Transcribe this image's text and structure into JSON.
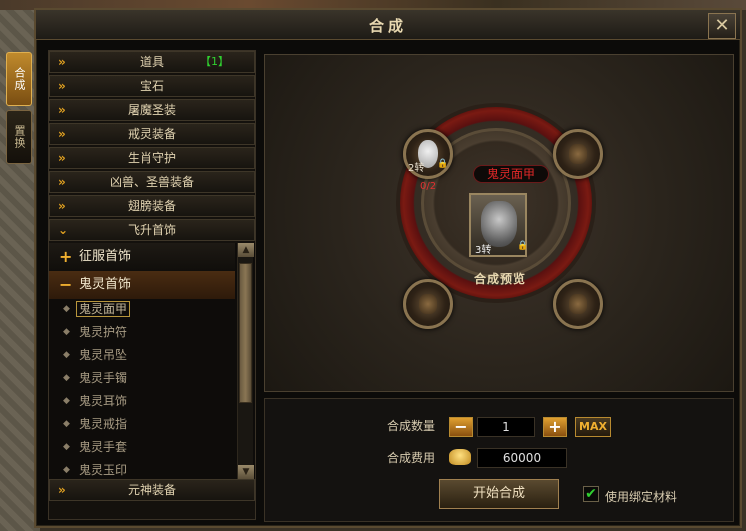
{
  "window": {
    "title": "合成",
    "close_label": "✕"
  },
  "side_tabs": [
    {
      "label": "合成",
      "active": true
    },
    {
      "label": "置换",
      "active": false
    }
  ],
  "categories_top": [
    {
      "label": "道具",
      "count": "【1】"
    },
    {
      "label": "宝石"
    },
    {
      "label": "屠魔圣装"
    },
    {
      "label": "戒灵装备"
    },
    {
      "label": "生肖守护"
    },
    {
      "label": "凶兽、圣兽装备"
    },
    {
      "label": "翅膀装备"
    },
    {
      "label": "飞升首饰",
      "expanded": true
    }
  ],
  "sub_groups": [
    {
      "label": "征服首饰",
      "sign": "+"
    },
    {
      "label": "鬼灵首饰",
      "sign": "−"
    }
  ],
  "sub_items": [
    "鬼灵面甲",
    "鬼灵护符",
    "鬼灵吊坠",
    "鬼灵手镯",
    "鬼灵耳饰",
    "鬼灵戒指",
    "鬼灵手套",
    "鬼灵玉印"
  ],
  "selected_item": "鬼灵面甲",
  "category_bottom": {
    "label": "元神装备"
  },
  "scroll": {
    "up_icon": "▲",
    "down_icon": "▼"
  },
  "synthesis": {
    "target_name": "鬼灵面甲",
    "preview_label": "合成预览",
    "center_level": "3转",
    "material_level": "2转",
    "material_count": "0/2"
  },
  "controls": {
    "qty_label": "合成数量",
    "qty_value": "1",
    "minus": "−",
    "plus": "+",
    "max": "MAX",
    "cost_label": "合成费用",
    "cost_value": "60000",
    "start_button": "开始合成",
    "bind_checkbox_label": "使用绑定材料",
    "bind_checked": true,
    "check_mark": "✔"
  },
  "icons": {
    "arrow": "»",
    "dot": "◆",
    "lock": "🔒"
  },
  "colors": {
    "accent": "#e0a020",
    "name_red": "#e02828",
    "count_green": "#30d030"
  }
}
